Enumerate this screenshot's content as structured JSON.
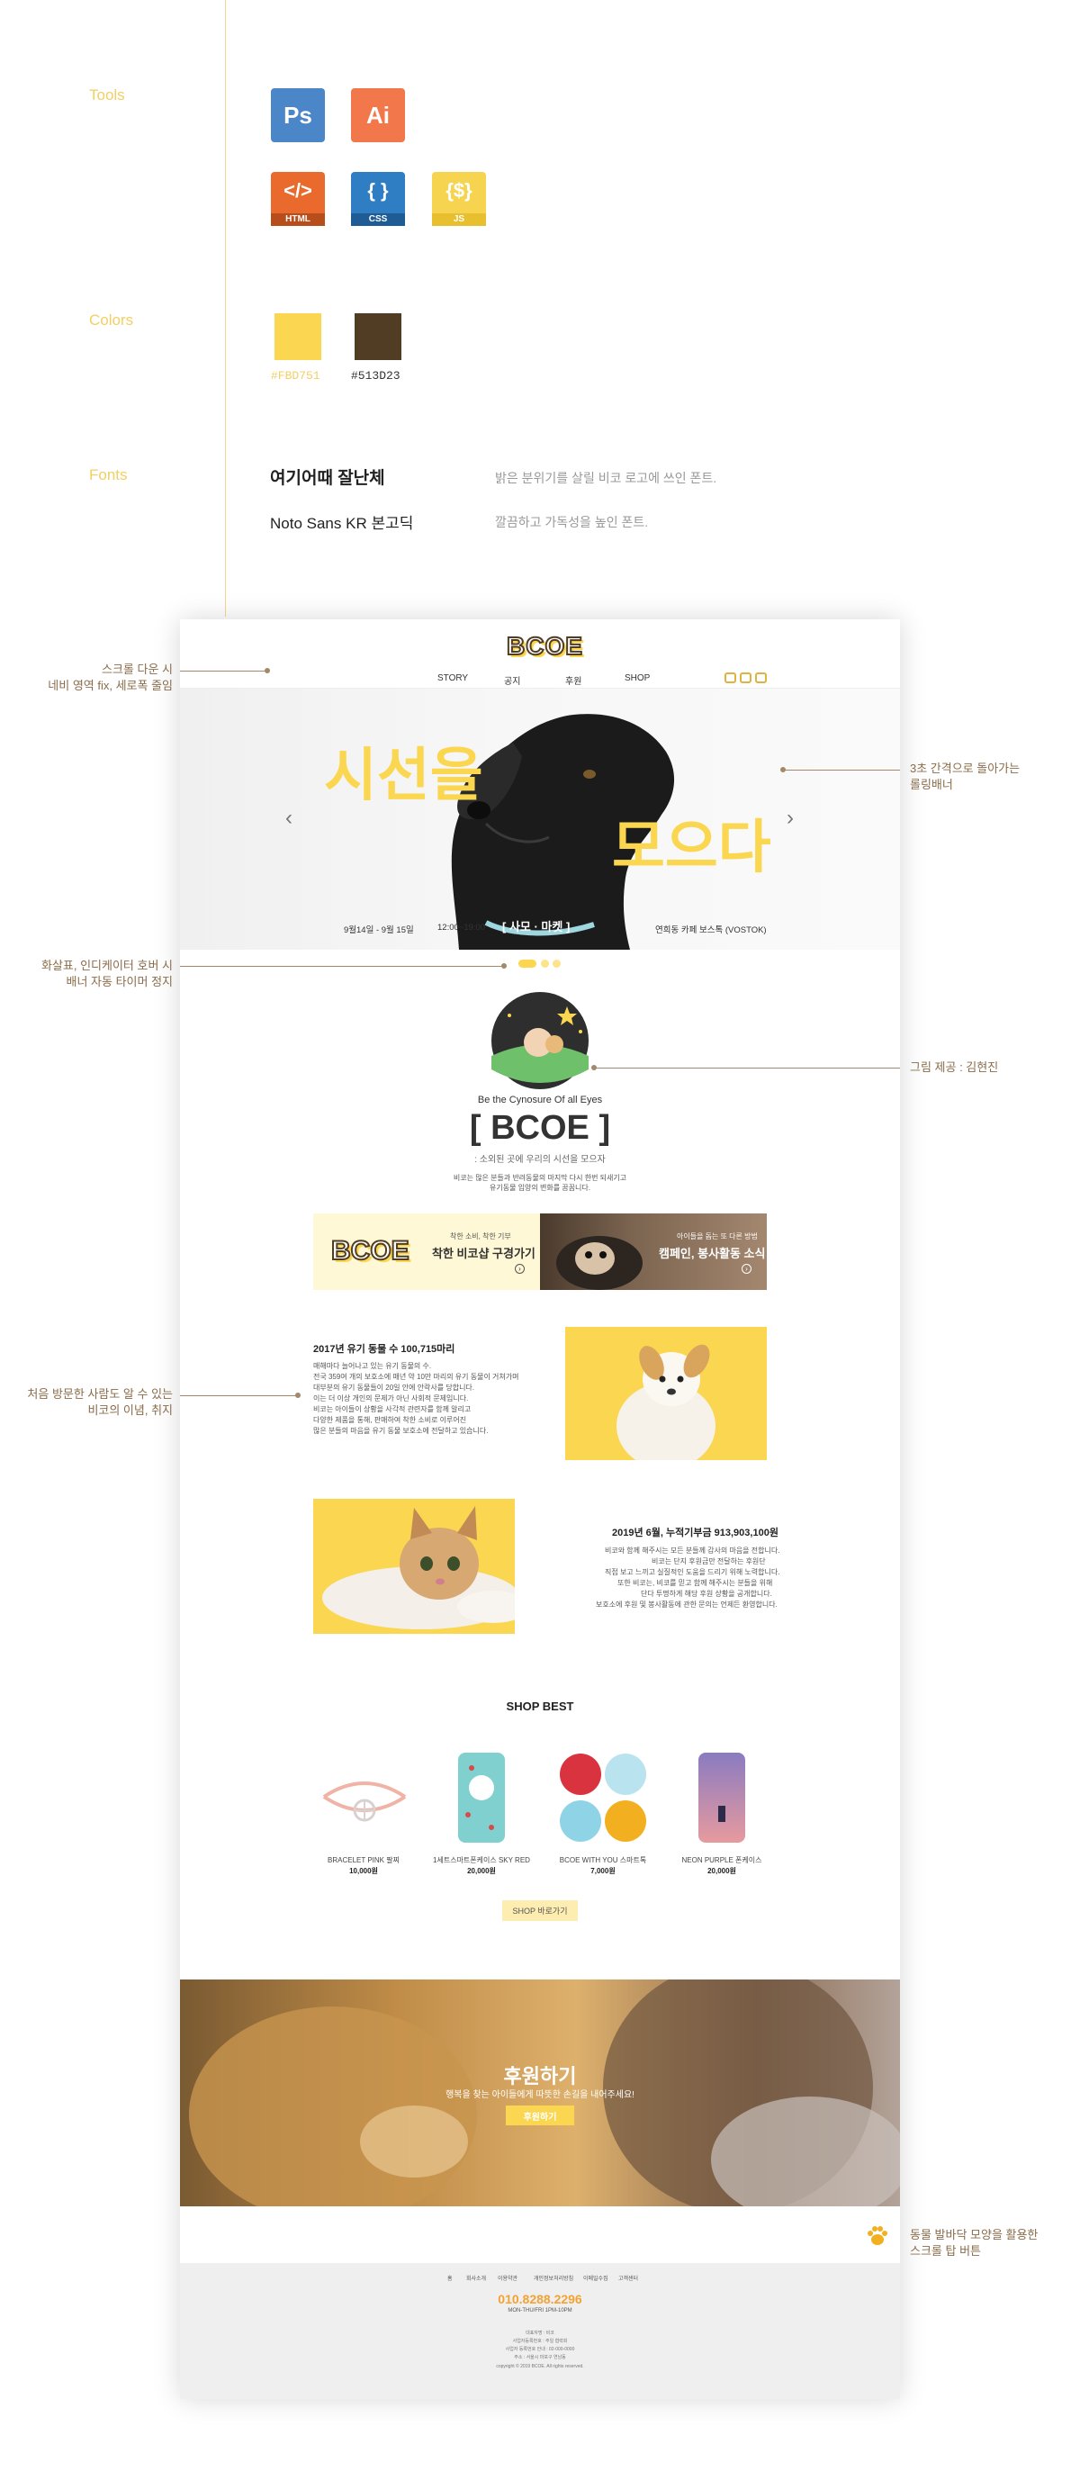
{
  "guide": {
    "tools_label": "Tools",
    "colors_label": "Colors",
    "fonts_label": "Fonts",
    "tools": {
      "ps": "Ps",
      "ai": "Ai",
      "html_glyph": "</>",
      "html_name": "HTML",
      "css_glyph": "{ }",
      "css_name": "CSS",
      "js_glyph": "{$}",
      "js_name": "JS"
    },
    "tool_colors": {
      "ps": "#4a86c8",
      "ai": "#f2784b",
      "html": "#e96a2c",
      "css": "#2f7dc2",
      "js": "#f7d44f"
    },
    "colors": [
      {
        "hex": "#FBD751",
        "label": "#FBD751"
      },
      {
        "hex": "#513D23",
        "label": "#513D23"
      }
    ],
    "fonts": [
      {
        "name": "여기어때 잘난체",
        "desc": "밝은 분위기를 살릴 비코 로고에 쓰인 폰트."
      },
      {
        "name": "Noto Sans KR 본고딕",
        "desc": "깔끔하고 가독성을 높인 폰트."
      }
    ]
  },
  "site": {
    "logo": "BCOE",
    "nav": [
      "STORY",
      "공지",
      "후원",
      "SHOP"
    ],
    "nav_icons": [
      "instagram-icon",
      "facebook-icon",
      "blog-icon"
    ],
    "banner": {
      "title_1": "시선을",
      "title_2": "모으다",
      "date": "9월14일 - 9월 15일",
      "time": "12:00~19:00",
      "tag": "[ 사모 · 마켓 ]",
      "place": "연희동 카페 보스톡 (VOSTOK)",
      "prev": "‹",
      "next": "›"
    },
    "intro": {
      "eng": "Be the Cynosure Of all Eyes",
      "title": "[ BCOE ]",
      "sub": ": 소외된 곳에 우리의 시선을 모으자",
      "desc_1": "비코는 많은 분들과 반려동물의 마지막 다시 한번 되새기고",
      "desc_2": "유기동물 입양의 변화를 꿈꿉니다."
    },
    "cards": [
      {
        "logo": "BCOE",
        "small": "착한 소비, 착한 기부",
        "big": "착한 비코샵 구경가기",
        "more": "›"
      },
      {
        "small": "아이들을 돕는 또 다른 방법",
        "big": "캠페인, 봉사활동 소식",
        "more": "›"
      }
    ],
    "stat_1": {
      "title": "2017년 유기 동물 수 100,715마리",
      "lines": [
        "매해마다 늘어나고 있는 유기 동물의 수.",
        "전국 359여 개의 보호소에 매년 약 10만 마리의 유기 동물이 거쳐가며",
        "대부분의 유기 동물들이 20일 안에 안락사를 당합니다.",
        "이는 더 이상 개인의 문제가 아닌 사회적 문제입니다.",
        "비코는 아이들이 상황을 사각적 관련자를 함께 알리고",
        "다양한 제품을 통해, 판매하여 착한 소비로 이루어진",
        "많은 분들의 마음을 유기 동물 보호소에 전달하고 있습니다."
      ]
    },
    "stat_2": {
      "title": "2019년 6월, 누적기부금 913,903,100원",
      "lines": [
        "비코와 함께 해주시는 모든 분들께 감사의 마음을 전합니다.",
        "비코는 단지 후원금만 전달하는 후원단",
        "직접 보고 느끼고 실질적인 도움을 드리기 위해 노력합니다.",
        "또한 비코는, 비코를 믿고 함께 해주시는 분들을 위해",
        "단다 투명하게 해당 후원 상황을 공개합니다.",
        "보호소에 후원 및 봉사활동에 관한 문의는 언제든 환영합니다."
      ]
    },
    "shop": {
      "title": "SHOP BEST",
      "button": "SHOP 바로가기",
      "products": [
        {
          "name": "BRACELET PINK 팔찌",
          "price": "10,000원"
        },
        {
          "name": "1세트스마트폰케이스 SKY RED",
          "price": "20,000원"
        },
        {
          "name": "BCOE WITH YOU 스마트톡",
          "price": "7,000원"
        },
        {
          "name": "NEON PURPLE 폰케이스",
          "price": "20,000원"
        }
      ]
    },
    "donate": {
      "title": "후원하기",
      "sub": "행복을 찾는 아이들에게 따뜻한 손길을 내어주세요!",
      "button": "후원하기"
    },
    "footer": {
      "links": [
        "홈",
        "회사소개",
        "이용약관",
        "개인정보처리방침",
        "이메일수집",
        "고객센터"
      ],
      "phone": "010.8288.2296",
      "hours": "MON-THU/FRI 1PM-10PM",
      "lines": [
        "대표자명 : 비코",
        "사업자등록번호 : 주일 협력회",
        "사업자 등록번호 안내 : 02-000-0000",
        "주소 : 서울시 마포구 연남동",
        "copyright © 2019 BCOE. All rights reserved."
      ]
    }
  },
  "annotations": {
    "nav_fix_1": "스크롤 다운 시",
    "nav_fix_2": "네비 영역 fix, 세로폭 줄임",
    "rolling_1": "3초 간격으로 돌아가는",
    "rolling_2": "롤링배너",
    "indicator_1": "화살표, 인디케이터 호버 시",
    "indicator_2": "배너 자동 타이머 정지",
    "credit": "그림 제공 : 김현진",
    "vision_1": "처음 방문한 사람도 알 수 있는",
    "vision_2": "비코의 이념, 취지",
    "paw_1": "동물 발바닥 모양을 활용한",
    "paw_2": "스크롤 탑 버튼"
  }
}
